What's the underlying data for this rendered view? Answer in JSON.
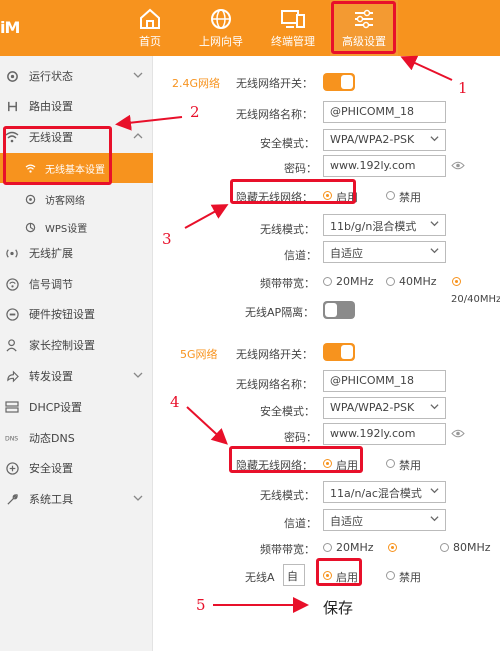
{
  "header": {
    "logo": "iM",
    "nav": [
      {
        "label": "首页"
      },
      {
        "label": "上网向导"
      },
      {
        "label": "终端管理"
      },
      {
        "label": "高级设置"
      }
    ]
  },
  "sidebar": {
    "items": [
      {
        "label": "运行状态"
      },
      {
        "label": "路由设置"
      },
      {
        "label": "无线设置"
      },
      {
        "label": "无线基本设置"
      },
      {
        "label": "访客网络"
      },
      {
        "label": "WPS设置"
      },
      {
        "label": "无线扩展"
      },
      {
        "label": "信号调节"
      },
      {
        "label": "硬件按钮设置"
      },
      {
        "label": "家长控制设置"
      },
      {
        "label": "转发设置"
      },
      {
        "label": "DHCP设置"
      },
      {
        "label": "动态DNS"
      },
      {
        "label": "安全设置"
      },
      {
        "label": "系统工具"
      }
    ]
  },
  "band24": {
    "section": "2.4G网络",
    "switch_label": "无线网络开关：",
    "ssid_label": "无线网络名称：",
    "ssid": "@PHICOMM_18",
    "security_label": "安全模式：",
    "security": "WPA/WPA2-PSK",
    "password_label": "密码：",
    "password": "www.192ly.com",
    "hide_label": "隐藏无线网络：",
    "enable": "启用",
    "disable": "禁用",
    "mode_label": "无线模式：",
    "mode": "11b/g/n混合模式",
    "channel_label": "信道：",
    "channel": "自适应",
    "bandwidth_label": "频带带宽：",
    "bw1": "20MHz",
    "bw2": "40MHz",
    "bw3": "20/40MHz",
    "ap_label": "无线AP隔离："
  },
  "band5": {
    "section": "5G网络",
    "switch_label": "无线网络开关：",
    "ssid_label": "无线网络名称：",
    "ssid": "@PHICOMM_18",
    "security_label": "安全模式：",
    "security": "WPA/WPA2-PSK",
    "password_label": "密码：",
    "password": "www.192ly.com",
    "hide_label": "隐藏无线网络：",
    "enable": "启用",
    "disable": "禁用",
    "mode_label": "无线模式：",
    "mode": "11a/n/ac混合模式",
    "channel_label": "信道：",
    "channel": "自适应",
    "bandwidth_label": "频带带宽：",
    "bw1": "20MHz",
    "bw3": "80MHz",
    "ap_label": "无线A",
    "ap_cut": "自",
    "enable2": "启用",
    "disable2": "禁用"
  },
  "annotations": {
    "n1": "1",
    "n2": "2",
    "n3": "3",
    "n4": "4",
    "n5": "5",
    "save": "保存"
  },
  "colors": {
    "accent": "#f7931e",
    "annotation_red": "#e8102a"
  }
}
